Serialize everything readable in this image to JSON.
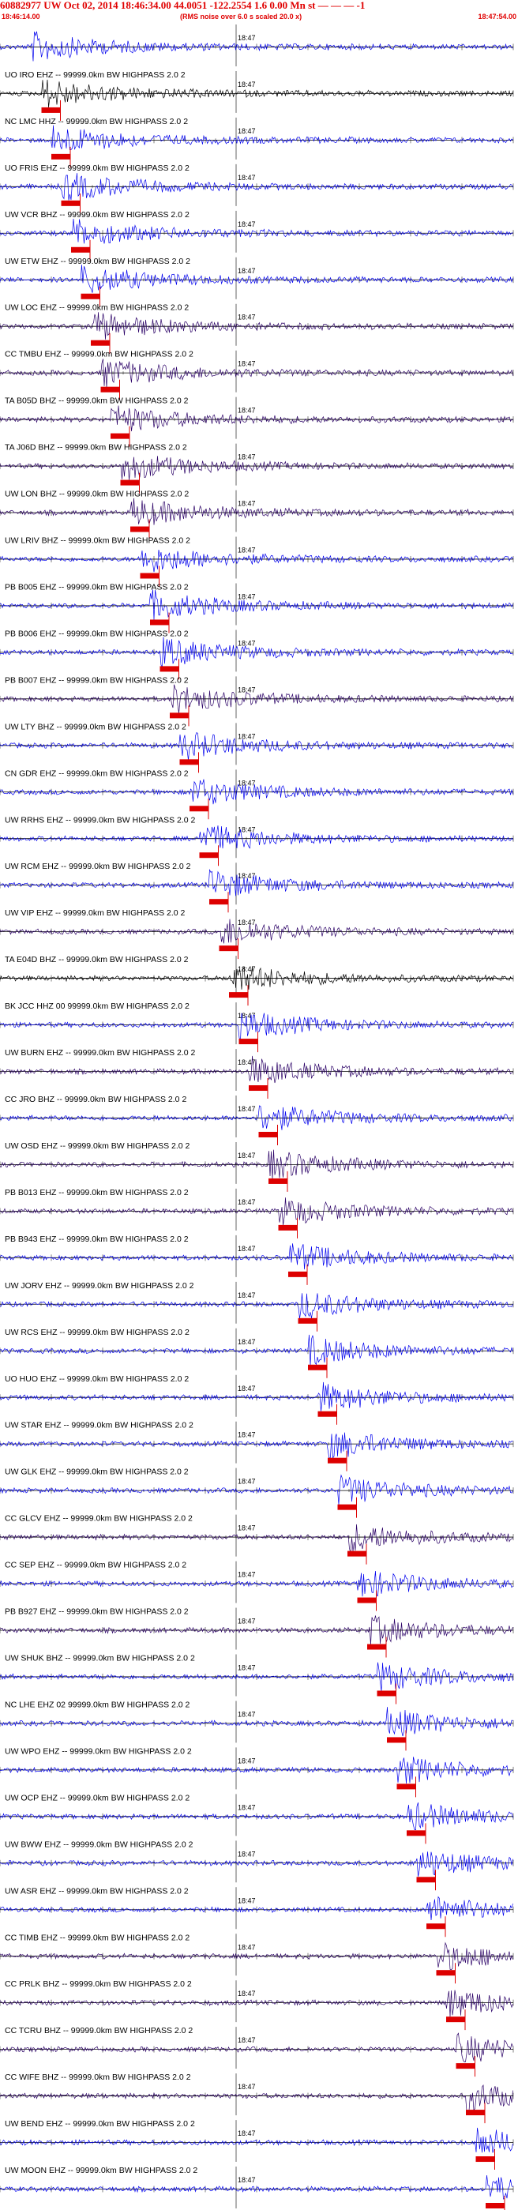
{
  "header": {
    "title": "60882977 UW Oct 02, 2014 18:46:34.00   44.0051 -122.2554  1.6 0.00 Mn st — — —  -1",
    "start_time": "18:46:14.00",
    "note": "(RMS noise over 6.0 s scaled 20.0 x)",
    "end_time": "18:47:54.00"
  },
  "colors": {
    "header_text": "#e00000",
    "trace_blue": "#0000ee",
    "trace_purple": "#2a0066",
    "trace_black": "#000000",
    "pick_marker": "#dd0000",
    "baseline": "#000000"
  },
  "chart_data": {
    "type": "seismogram",
    "time_range": [
      "18:46:14.00",
      "18:47:54.00"
    ],
    "minute_tick_label": "18:47",
    "minute_tick_time": "18:47:00",
    "traces": [
      {
        "label": "",
        "color": "blue"
      },
      {
        "label": "UO IRO EHZ -- 99999.0km BW  HIGHPASS  2.0  2",
        "color": "black"
      },
      {
        "label": "NC LMC HHZ -- 99999.0km BW  HIGHPASS  2.0  2",
        "color": "blue"
      },
      {
        "label": "UO FRIS EHZ -- 99999.0km BW  HIGHPASS  2.0  2",
        "color": "blue"
      },
      {
        "label": "UW VCR BHZ -- 99999.0km BW  HIGHPASS  2.0  2",
        "color": "blue"
      },
      {
        "label": "UW ETW EHZ -- 99999.0km BW  HIGHPASS  2.0  2",
        "color": "blue"
      },
      {
        "label": "UW LOC EHZ -- 99999.0km BW  HIGHPASS  2.0  2",
        "color": "purple"
      },
      {
        "label": "CC TMBU EHZ -- 99999.0km BW  HIGHPASS  2.0  2",
        "color": "purple"
      },
      {
        "label": "TA B05D BHZ -- 99999.0km BW  HIGHPASS  2.0  2",
        "color": "purple"
      },
      {
        "label": "TA J06D BHZ -- 99999.0km BW  HIGHPASS  2.0  2",
        "color": "purple"
      },
      {
        "label": "UW LON BHZ -- 99999.0km BW  HIGHPASS  2.0  2",
        "color": "purple"
      },
      {
        "label": "UW LRIV BHZ -- 99999.0km BW  HIGHPASS  2.0  2",
        "color": "blue"
      },
      {
        "label": "PB B005 EHZ -- 99999.0km BW  HIGHPASS  2.0  2",
        "color": "blue"
      },
      {
        "label": "PB B006 EHZ -- 99999.0km BW  HIGHPASS  2.0  2",
        "color": "blue"
      },
      {
        "label": "PB B007 EHZ -- 99999.0km BW  HIGHPASS  2.0  2",
        "color": "purple"
      },
      {
        "label": "UW LTY BHZ -- 99999.0km BW  HIGHPASS  2.0  2",
        "color": "blue"
      },
      {
        "label": "CN GDR EHZ -- 99999.0km BW  HIGHPASS  2.0  2",
        "color": "blue"
      },
      {
        "label": "UW RRHS EHZ -- 99999.0km BW  HIGHPASS  2.0  2",
        "color": "blue"
      },
      {
        "label": "UW RCM EHZ -- 99999.0km BW  HIGHPASS  2.0  2",
        "color": "blue"
      },
      {
        "label": "UW VIP EHZ -- 99999.0km BW  HIGHPASS  2.0  2",
        "color": "purple"
      },
      {
        "label": "TA E04D BHZ -- 99999.0km BW  HIGHPASS  2.0  2",
        "color": "black"
      },
      {
        "label": "BK JCC HHZ 00 99999.0km BW  HIGHPASS  2.0  2",
        "color": "blue"
      },
      {
        "label": "UW BURN EHZ -- 99999.0km BW  HIGHPASS  2.0  2",
        "color": "purple"
      },
      {
        "label": "CC JRO BHZ -- 99999.0km BW  HIGHPASS  2.0  2",
        "color": "blue"
      },
      {
        "label": "UW OSD EHZ -- 99999.0km BW  HIGHPASS  2.0  2",
        "color": "purple"
      },
      {
        "label": "PB B013 EHZ -- 99999.0km BW  HIGHPASS  2.0  2",
        "color": "purple"
      },
      {
        "label": "PB B943 EHZ -- 99999.0km BW  HIGHPASS  2.0  2",
        "color": "blue"
      },
      {
        "label": "UW JORV EHZ -- 99999.0km BW  HIGHPASS  2.0  2",
        "color": "blue"
      },
      {
        "label": "UW RCS EHZ -- 99999.0km BW  HIGHPASS  2.0  2",
        "color": "blue"
      },
      {
        "label": "UO HUO EHZ -- 99999.0km BW  HIGHPASS  2.0  2",
        "color": "blue"
      },
      {
        "label": "UW STAR EHZ -- 99999.0km BW  HIGHPASS  2.0  2",
        "color": "blue"
      },
      {
        "label": "UW GLK EHZ -- 99999.0km BW  HIGHPASS  2.0  2",
        "color": "blue"
      },
      {
        "label": "CC GLCV EHZ -- 99999.0km BW  HIGHPASS  2.0  2",
        "color": "purple"
      },
      {
        "label": "CC SEP EHZ -- 99999.0km BW  HIGHPASS  2.0  2",
        "color": "blue"
      },
      {
        "label": "PB B927 EHZ -- 99999.0km BW  HIGHPASS  2.0  2",
        "color": "purple"
      },
      {
        "label": "UW SHUK BHZ -- 99999.0km BW  HIGHPASS  2.0  2",
        "color": "blue"
      },
      {
        "label": "NC LHE EHZ 02 99999.0km BW  HIGHPASS  2.0  2",
        "color": "blue"
      },
      {
        "label": "UW WPO EHZ -- 99999.0km BW  HIGHPASS  2.0  2",
        "color": "blue"
      },
      {
        "label": "UW OCP EHZ -- 99999.0km BW  HIGHPASS  2.0  2",
        "color": "blue"
      },
      {
        "label": "UW BWW EHZ -- 99999.0km BW  HIGHPASS  2.0  2",
        "color": "blue"
      },
      {
        "label": "UW ASR EHZ -- 99999.0km BW  HIGHPASS  2.0  2",
        "color": "blue"
      },
      {
        "label": "CC TIMB EHZ -- 99999.0km BW  HIGHPASS  2.0  2",
        "color": "purple"
      },
      {
        "label": "CC PRLK BHZ -- 99999.0km BW  HIGHPASS  2.0  2",
        "color": "purple"
      },
      {
        "label": "CC TCRU BHZ -- 99999.0km BW  HIGHPASS  2.0  2",
        "color": "purple"
      },
      {
        "label": "CC WIFE BHZ -- 99999.0km BW  HIGHPASS  2.0  2",
        "color": "purple"
      },
      {
        "label": "UW BEND EHZ -- 99999.0km BW  HIGHPASS  2.0  2",
        "color": "blue"
      },
      {
        "label": "UW MOON EHZ -- 99999.0km BW  HIGHPASS  2.0  2",
        "color": "blue"
      }
    ]
  }
}
